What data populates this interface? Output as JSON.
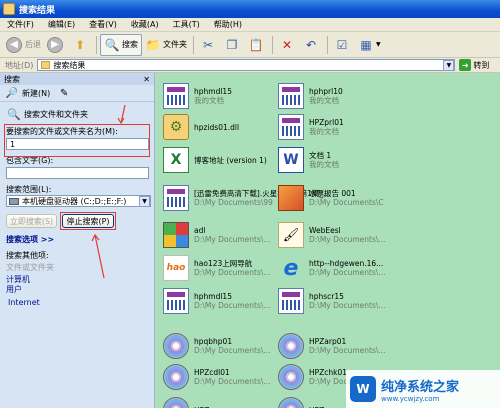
{
  "window": {
    "title": "搜索结果"
  },
  "menu": [
    "文件(F)",
    "编辑(E)",
    "查看(V)",
    "收藏(A)",
    "工具(T)",
    "帮助(H)"
  ],
  "toolbar": {
    "back": "后退",
    "search": "搜索",
    "folders": "文件夹"
  },
  "address": {
    "label": "地址(D)",
    "value": "搜索结果",
    "go": "转到"
  },
  "search_pane": {
    "title": "搜索",
    "new_btn": "新建(N)",
    "search_files": "搜索文件和文件夹",
    "name_label": "要搜索的文件或文件夹名为(M):",
    "name_value": "1",
    "contains_label": "包含文字(G):",
    "contains_value": "",
    "look_in_label": "搜索范围(L):",
    "look_in_value": "本机硬盘驱动器 (C:;D:;E:;F:)",
    "search_now_btn": "立即搜索(S)",
    "stop_btn": "停止搜索(P)",
    "options_link": "搜索选项 >>",
    "other_label": "搜索其他项:",
    "other_items": [
      "文件或文件夹",
      "计算机",
      "用户",
      "Internet"
    ]
  },
  "files": [
    {
      "name": "hphmdl15",
      "sub": "我的文档",
      "icon": "doc"
    },
    {
      "name": "hphprl10",
      "sub": "我的文档",
      "icon": "doc"
    },
    {
      "name": "hpzids01.dll",
      "sub": "",
      "icon": "dll"
    },
    {
      "name": "HPZprl01",
      "sub": "我的文档",
      "icon": "doc"
    },
    {
      "name": "博客地址 (version 1)",
      "sub": "",
      "icon": "xls"
    },
    {
      "name": "文档 1",
      "sub": "我的文档",
      "icon": "word"
    },
    {
      "name": "[迅雷免费高清下载].火星打锤__第1集_...",
      "sub": "D:\\My Documents\\99",
      "icon": "doc"
    },
    {
      "name": "水票报告 001",
      "sub": "D:\\My Documents\\C",
      "icon": "pic"
    },
    {
      "name": "adl",
      "sub": "D:\\My Documents\\...",
      "icon": "multi"
    },
    {
      "name": "WebEesl",
      "sub": "D:\\My Documents\\...",
      "icon": "brush"
    },
    {
      "name": "hao123上网导航",
      "sub": "D:\\My Documents\\...",
      "icon": "hao"
    },
    {
      "name": "http--hdgewen.16...",
      "sub": "D:\\My Documents\\...",
      "icon": "ie"
    },
    {
      "name": "hphmdl15",
      "sub": "D:\\My Documents\\...",
      "icon": "doc"
    },
    {
      "name": "hphscr15",
      "sub": "D:\\My Documents\\...",
      "icon": "doc"
    },
    {
      "name": "hpqbhp01",
      "sub": "D:\\My Documents\\...",
      "icon": "cd"
    },
    {
      "name": "HPZarp01",
      "sub": "D:\\My Documents\\...",
      "icon": "cd"
    },
    {
      "name": "HPZcdl01",
      "sub": "D:\\My Documents\\...",
      "icon": "cd"
    },
    {
      "name": "HPZchk01",
      "sub": "D:\\My Documents\\...",
      "icon": "cd"
    },
    {
      "name": "HPZ...",
      "sub": "",
      "icon": "cd"
    },
    {
      "name": "HPZ...",
      "sub": "",
      "icon": "cd"
    }
  ],
  "watermark": {
    "text": "纯净系统之家",
    "url": "www.ycwjzy.com"
  }
}
